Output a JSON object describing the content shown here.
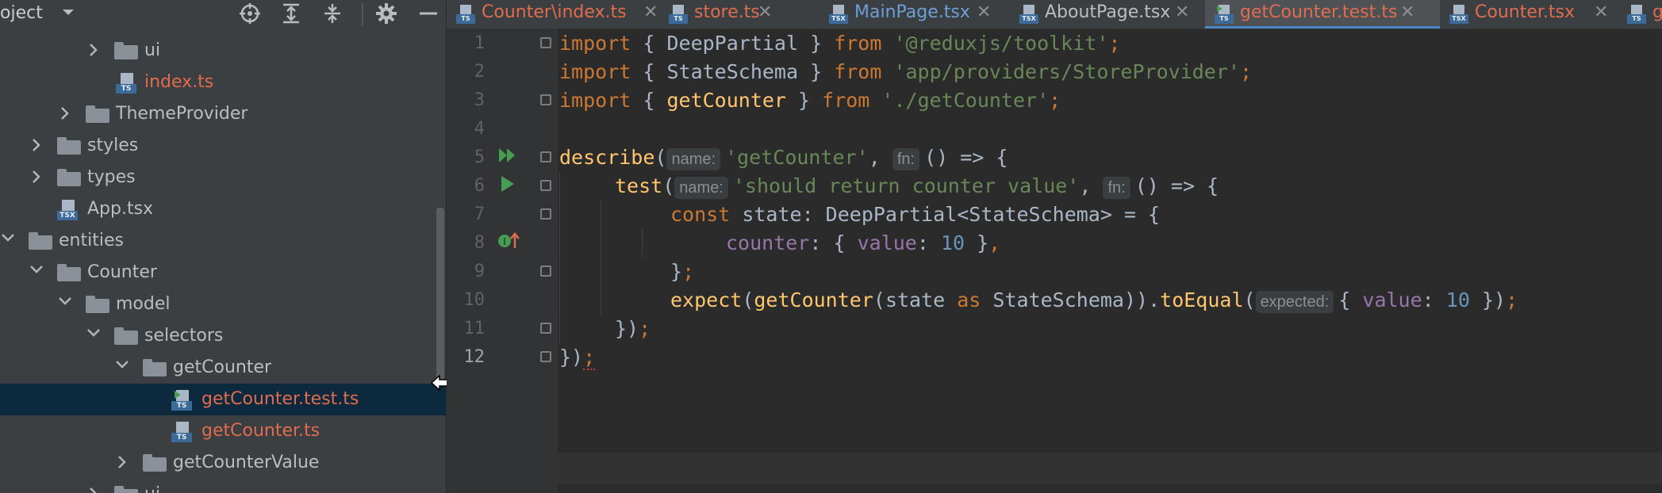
{
  "project_panel": {
    "title": "oject",
    "icons": [
      "chevron-down-icon",
      "locate-icon",
      "expand-all-icon",
      "collapse-all-icon",
      "gear-icon",
      "minimize-icon"
    ],
    "tree": [
      {
        "label": "ui",
        "type": "folder",
        "arrow": "collapsed",
        "indent": 0
      },
      {
        "label": "index.ts",
        "type": "ts",
        "modified": true,
        "indent": 1
      },
      {
        "label": "ThemeProvider",
        "type": "folder",
        "arrow": "collapsed",
        "indent": 2
      },
      {
        "label": "styles",
        "type": "folder",
        "arrow": "collapsed",
        "indent": 3
      },
      {
        "label": "types",
        "type": "folder",
        "arrow": "collapsed",
        "indent": 4
      },
      {
        "label": "App.tsx",
        "type": "tsx",
        "indent": 5
      },
      {
        "label": "entities",
        "type": "folder",
        "arrow": "expanded",
        "indent": 6
      },
      {
        "label": "Counter",
        "type": "folder",
        "arrow": "expanded",
        "indent": 7
      },
      {
        "label": "model",
        "type": "folder",
        "arrow": "expanded",
        "indent": 8
      },
      {
        "label": "selectors",
        "type": "folder",
        "arrow": "expanded",
        "indent": 9
      },
      {
        "label": "getCounter",
        "type": "folder",
        "arrow": "expanded",
        "indent": 10
      },
      {
        "label": "getCounter.test.ts",
        "type": "test",
        "modified": true,
        "selected": true,
        "indent": 11
      },
      {
        "label": "getCounter.ts",
        "type": "ts",
        "modified": true,
        "indent": 12
      },
      {
        "label": "getCounterValue",
        "type": "folder",
        "arrow": "collapsed",
        "indent": 13
      },
      {
        "label": "ui",
        "type": "folder",
        "arrow": "collapsed",
        "indent": 14
      }
    ]
  },
  "tabs": [
    {
      "label": "Counter\\index.ts",
      "icon": "ts",
      "style": "modified",
      "close": "✕"
    },
    {
      "label": "store.ts",
      "icon": "ts",
      "style": "modified",
      "close": "✕"
    },
    {
      "label": "MainPage.tsx",
      "icon": "tsx",
      "style": "blue",
      "close": "✕"
    },
    {
      "label": "AboutPage.tsx",
      "icon": "tsx",
      "style": "normal",
      "close": "✕"
    },
    {
      "label": "getCounter.test.ts",
      "icon": "test",
      "style": "modified",
      "active": true,
      "close": "✕"
    },
    {
      "label": "Counter.tsx",
      "icon": "tsx",
      "style": "modified",
      "close": "✕"
    },
    {
      "label": "g",
      "icon": "ts",
      "style": "modified",
      "close": ""
    }
  ],
  "editor": {
    "line_numbers": [
      "1",
      "2",
      "3",
      "4",
      "5",
      "6",
      "7",
      "8",
      "9",
      "10",
      "11",
      "12"
    ],
    "current_line": "12",
    "code": {
      "l1": {
        "kw": "import",
        "a": " { DeepPartial } ",
        "kw2": "from",
        "str": " '@reduxjs/toolkit'",
        "end": ";"
      },
      "l2": {
        "kw": "import",
        "a": " { StateSchema } ",
        "kw2": "from",
        "str": " 'app/providers/StoreProvider'",
        "end": ";"
      },
      "l3": {
        "kw": "import",
        "a": " { ",
        "fn": "getCounter",
        "b": " } ",
        "kw2": "from",
        "str": " './getCounter'",
        "end": ";"
      },
      "l5": {
        "fn": "describe",
        "a": "(",
        "hint1": "name:",
        "str": "'getCounter'",
        "b": ", ",
        "hint2": "fn:",
        "c": "() => {"
      },
      "l6": {
        "fn": "test",
        "a": "(",
        "hint1": "name:",
        "str": "'should return counter value'",
        "b": ", ",
        "hint2": "fn:",
        "c": "() => {"
      },
      "l7": {
        "kw": "const",
        "a": " state: DeepPartial<StateSchema> = {"
      },
      "l8": {
        "prop": "counter",
        "a": ": { ",
        "prop2": "value",
        "b": ": ",
        "num": "10",
        "c": " }",
        "end": ","
      },
      "l9": {
        "a": "}",
        "end": ";"
      },
      "l10": {
        "fn": "expect",
        "a": "(",
        "fn2": "getCounter",
        "b": "(state ",
        "kw": "as",
        "c": " StateSchema)).",
        "fn3": "toEqual",
        "d": "(",
        "hint": "expected:",
        "e": "{ ",
        "prop": "value",
        "f": ": ",
        "num": "10",
        "g": " })",
        "end": ";"
      },
      "l11": {
        "a": "})",
        "end": ";"
      },
      "l12": {
        "a": "})",
        "end": ";"
      }
    }
  }
}
